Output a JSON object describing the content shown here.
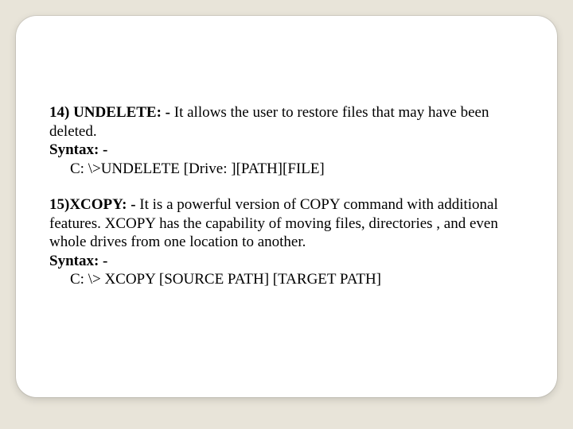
{
  "entries": [
    {
      "num": "14) ",
      "title": "UNDELETE: -",
      "desc": " It allows the user to restore files that may have been deleted.",
      "syntax_label": "Syntax: -",
      "syntax_line": "C: \\>UNDELETE [Drive: ][PATH][FILE]"
    },
    {
      "num": "15)",
      "title": "XCOPY: -",
      "desc": " It is a powerful version of COPY command with additional features. XCOPY has the capability of moving files, directories , and even whole drives from one location to another.",
      "syntax_label": "Syntax: -",
      "syntax_line": "C: \\> XCOPY [SOURCE PATH] [TARGET PATH]"
    }
  ]
}
